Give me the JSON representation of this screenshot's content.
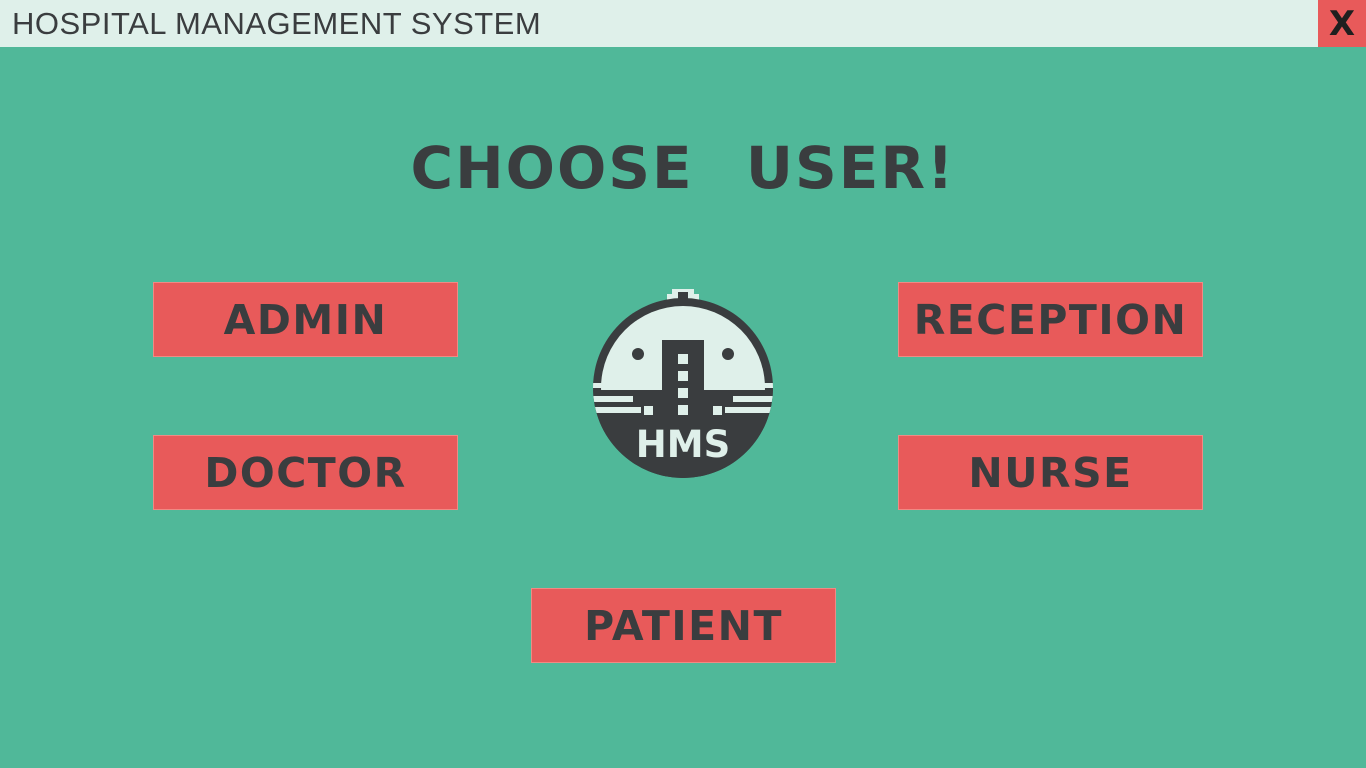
{
  "window": {
    "title": "HOSPITAL MANAGEMENT SYSTEM",
    "close_label": "X"
  },
  "main": {
    "heading": "CHOOSE USER!",
    "logo_text": "HMS",
    "buttons": {
      "admin": "ADMIN",
      "doctor": "DOCTOR",
      "reception": "RECEPTION",
      "nurse": "NURSE",
      "patient": "PATIENT"
    }
  },
  "colors": {
    "background": "#50b899",
    "titlebar": "#dff0ea",
    "button": "#e85a5a",
    "text_dark": "#3a3d3f",
    "logo_dark": "#3a3d3f",
    "logo_light": "#dff0ea"
  },
  "icons": {
    "close": "close-icon",
    "logo": "hospital-logo-icon"
  }
}
